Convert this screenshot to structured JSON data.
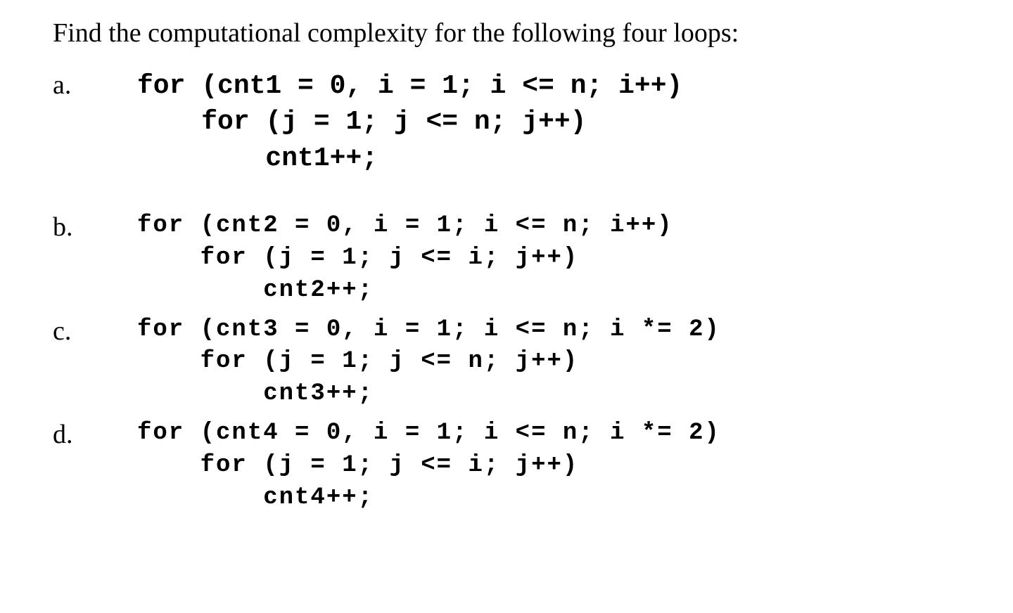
{
  "heading": "Find the computational complexity for the following four loops:",
  "items": [
    {
      "label": "a.",
      "code": "for (cnt1 = 0, i = 1; i <= n; i++)\n    for (j = 1; j <= n; j++)\n        cnt1++;",
      "style": "normal"
    },
    {
      "label": "b.",
      "code": "for (cnt2 = 0, i = 1; i <= n; i++)\n    for (j = 1; j <= i; j++)\n        cnt2++;",
      "style": "small"
    },
    {
      "label": "c.",
      "code": "for (cnt3 = 0, i = 1; i <= n; i *= 2)\n    for (j = 1; j <= n; j++)\n        cnt3++;",
      "style": "small"
    },
    {
      "label": "d.",
      "code": "for (cnt4 = 0, i = 1; i <= n; i *= 2)\n    for (j = 1; j <= i; j++)\n        cnt4++;",
      "style": "small"
    }
  ]
}
